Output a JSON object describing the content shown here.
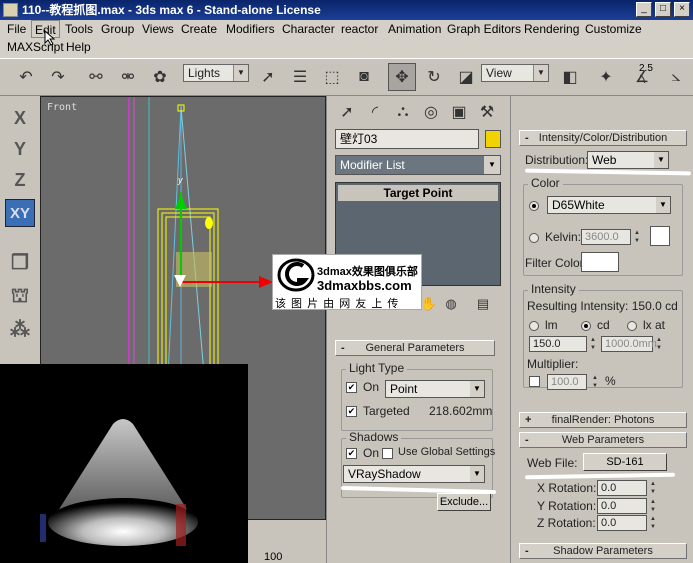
{
  "window": {
    "title": "110--教程抓图.max - 3ds max 6 - Stand-alone License",
    "min": "_",
    "max": "□",
    "close": "×"
  },
  "menu": {
    "row1": [
      "File",
      "Edit",
      "Tools",
      "Group",
      "Views",
      "Create",
      "Modifiers",
      "Character",
      "reactor",
      "Animation",
      "Graph Editors",
      "Rendering",
      "Customize"
    ],
    "row2": [
      "MAXScript",
      "Help"
    ]
  },
  "toolbar": {
    "selection_filter": "Lights",
    "reference_coord": "View",
    "snap_label": "2.5"
  },
  "axis_buttons": [
    "X",
    "Y",
    "Z",
    "XY"
  ],
  "viewport": {
    "label": "Front",
    "gizmo_y_label": "y",
    "ruler_value": "100"
  },
  "command_panel": {
    "object_name": "壁灯03",
    "object_color": "#f2d200",
    "modifier_list": "Modifier List",
    "stack_item": "Target Point",
    "general_params": {
      "title": "General Parameters",
      "light_type_group": "Light Type",
      "on_label": "On",
      "light_type_value": "Point",
      "targeted_label": "Targeted",
      "targeted_distance": "218.602mm",
      "shadows_group": "Shadows",
      "shadows_on_label": "On",
      "use_global_label": "Use Global Settings",
      "shadow_type": "VRayShadow",
      "exclude_button": "Exclude..."
    }
  },
  "right_panel": {
    "intensity_rollout": "Intensity/Color/Distribution",
    "distribution_label": "Distribution:",
    "distribution_value": "Web",
    "color_group": "Color",
    "color_preset": "D65White",
    "kelvin_label": "Kelvin:",
    "kelvin_value": "3600.0",
    "filter_color_label": "Filter Color:",
    "intensity_group": "Intensity",
    "resulting_intensity": "Resulting Intensity:  150.0 cd",
    "unit_lm": "lm",
    "unit_cd": "cd",
    "unit_lx": "lx at",
    "intensity_value": "150.0",
    "lx_distance": "1000.0mm",
    "multiplier_label": "Multiplier:",
    "multiplier_value": "100.0",
    "percent": "%",
    "final_render_rollout": "finalRender: Photons",
    "web_params_rollout": "Web Parameters",
    "web_file_label": "Web File:",
    "web_file_value": "SD-161",
    "x_rotation_label": "X Rotation:",
    "x_rotation_value": "0.0",
    "y_rotation_label": "Y Rotation:",
    "y_rotation_value": "0.0",
    "z_rotation_label": "Z Rotation:",
    "z_rotation_value": "0.0",
    "shadow_params_rollout": "Shadow Parameters"
  },
  "watermark": {
    "line1": "3dmax效果图俱乐部",
    "line2": "3dmaxbbs.com",
    "line3": "该 图 片 由 网 友 上 传"
  }
}
